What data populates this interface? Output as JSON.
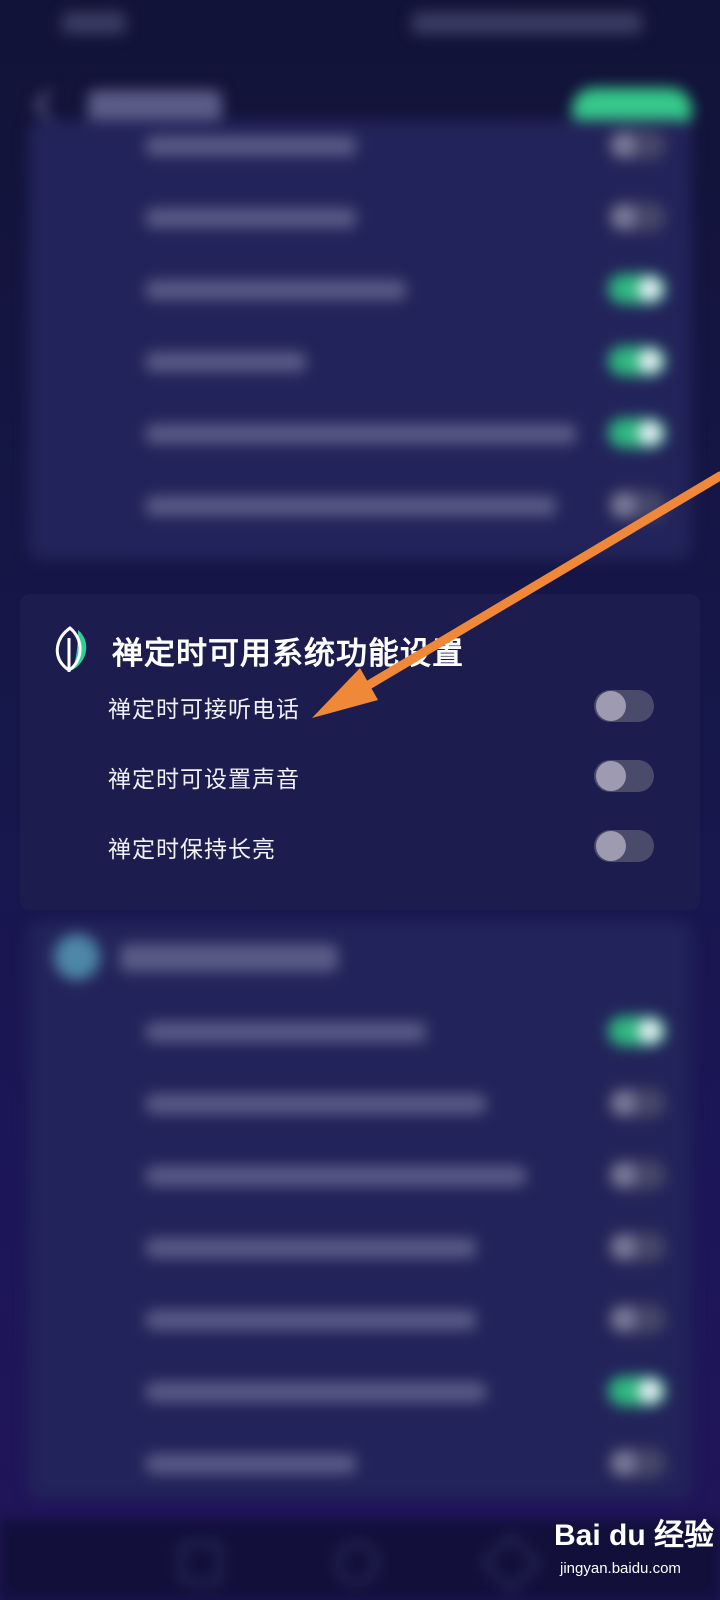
{
  "section": {
    "title": "禅定时可用系统功能设置",
    "icon": "leaf-icon",
    "items": [
      {
        "label": "禅定时可接听电话",
        "enabled": false
      },
      {
        "label": "禅定时可设置声音",
        "enabled": false
      },
      {
        "label": "禅定时保持长亮",
        "enabled": false
      }
    ]
  },
  "background_rows_top": [
    {
      "on": false
    },
    {
      "on": false
    },
    {
      "on": true
    },
    {
      "on": true
    },
    {
      "on": true
    },
    {
      "on": false
    }
  ],
  "background_rows_bottom": [
    {
      "on": true
    },
    {
      "on": false
    },
    {
      "on": false
    },
    {
      "on": false
    },
    {
      "on": false
    },
    {
      "on": true
    },
    {
      "on": false
    }
  ],
  "colors": {
    "accent_green": "#36c98a",
    "arrow": "#f0883a",
    "toggle_off": "#4a4a6a"
  },
  "watermark": {
    "logo": "Bai du 经验",
    "url": "jingyan.baidu.com"
  }
}
